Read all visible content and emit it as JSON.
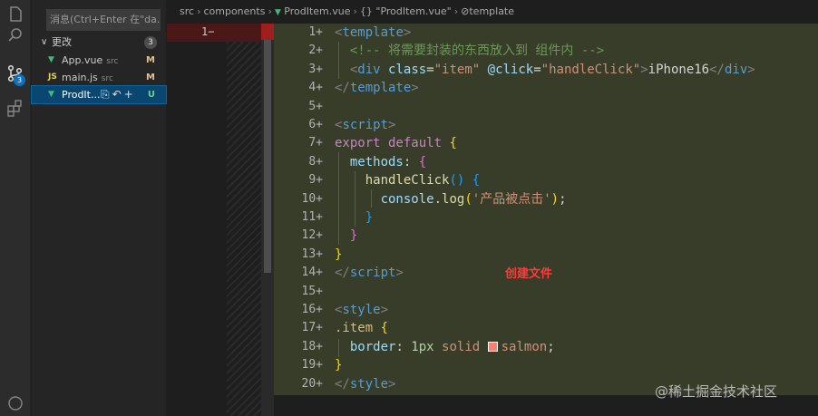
{
  "scm": {
    "commit_placeholder": "消息(Ctrl+Enter 在\"da...",
    "badge_count": "3",
    "group_label": "更改",
    "group_count": "3",
    "files": [
      {
        "name": "App.vue",
        "dir": "src",
        "status": "M",
        "icon": "vue-icon"
      },
      {
        "name": "main.js",
        "dir": "src",
        "status": "M",
        "icon": "js-icon"
      },
      {
        "name": "ProdIt...",
        "dir": "",
        "status": "U",
        "icon": "vue-icon"
      }
    ]
  },
  "breadcrumb": {
    "segments": [
      "src",
      "components",
      "ProdItem.vue",
      "{} \"ProdItem.vue\"",
      "template"
    ]
  },
  "left_pane": {
    "line_number": "1−"
  },
  "editor": {
    "line_numbers": [
      "1+",
      "2+",
      "3+",
      "4+",
      "5+",
      "6+",
      "7+",
      "8+",
      "9+",
      "10+",
      "11+",
      "12+",
      "13+",
      "14+",
      "15+",
      "16+",
      "17+",
      "18+",
      "19+",
      "20+"
    ],
    "tokens": {
      "template_tag": "template",
      "comment": "<!-- 将需要封装的东西放入到 组件内 -->",
      "div_tag": "div",
      "class_attr": "class",
      "class_val": "\"item\"",
      "click_attr": "@click",
      "click_val": "\"handleClick\"",
      "div_text": "iPhone16",
      "script_tag": "script",
      "export_kw": "export default",
      "methods": "methods",
      "handle_fn": "handleClick",
      "console": "console",
      "log_fn": "log",
      "log_str": "'产品被点击'",
      "style_tag": "style",
      "selector": ".item",
      "border_prop": "border",
      "border_num": "1px",
      "border_rest": "solid",
      "color_val": "salmon"
    },
    "salmon_color": "#fa8072"
  },
  "annotation": "创建文件",
  "watermark": "@稀土掘金技术社区"
}
